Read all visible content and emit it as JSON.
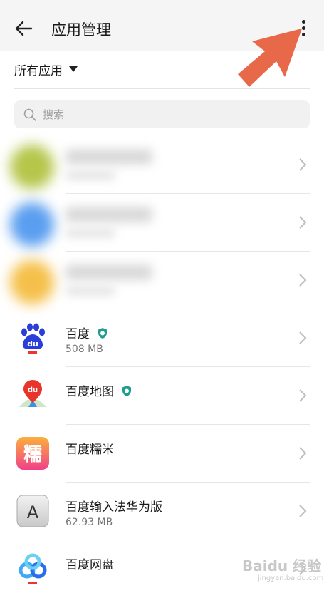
{
  "header": {
    "title": "应用管理",
    "back_icon": "arrow-left-icon",
    "more_icon": "more-vertical-icon"
  },
  "filter": {
    "label": "所有应用",
    "dropdown_icon": "caret-down-icon"
  },
  "search": {
    "placeholder": "搜索",
    "icon": "search-icon"
  },
  "colors": {
    "annotation_arrow": "#e8694a",
    "verified_badge": "#1f9e8e",
    "header_bg": "#f5f5f5"
  },
  "apps": [
    {
      "name": "百度",
      "size": "508 MB",
      "verified": true,
      "icon": "baidu-paw-icon"
    },
    {
      "name": "百度地图",
      "size": "",
      "verified": true,
      "icon": "baidu-map-pin-icon"
    },
    {
      "name": "百度糯米",
      "size": "",
      "verified": false,
      "icon": "baidu-nuomi-icon",
      "icon_char": "糯"
    },
    {
      "name": "百度输入法华为版",
      "size": "62.93 MB",
      "verified": false,
      "icon": "baidu-input-icon",
      "icon_char": "A"
    },
    {
      "name": "百度网盘",
      "size": "",
      "verified": false,
      "icon": "baidu-netdisk-icon"
    }
  ],
  "watermark": {
    "text": "Baidu 经验",
    "sub": "jingyan.baidu.com"
  }
}
